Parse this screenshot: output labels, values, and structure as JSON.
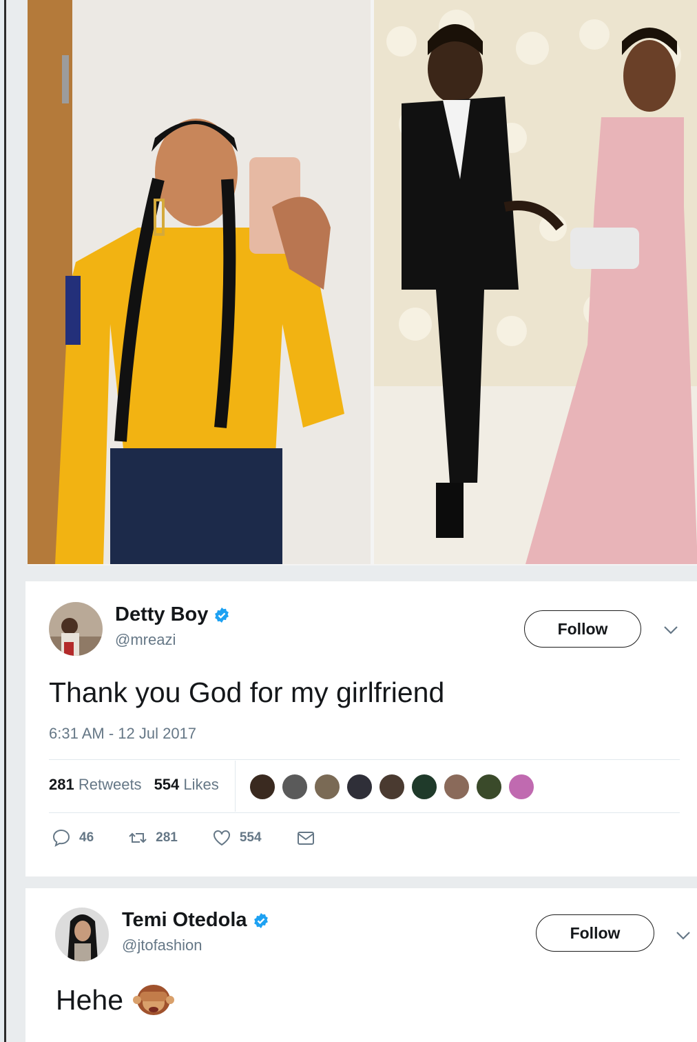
{
  "tweet1": {
    "display_name": "Detty Boy",
    "handle": "@mreazi",
    "follow_label": "Follow",
    "text": "Thank you God for my girlfriend",
    "timestamp": "6:31 AM - 12 Jul 2017",
    "retweets_count": "281",
    "retweets_label": "Retweets",
    "likes_count": "554",
    "likes_label": "Likes",
    "replies": "46",
    "retweets": "281",
    "likes": "554",
    "liker_colors": [
      "#3a2a20",
      "#5a5a5a",
      "#7a6a55",
      "#2f2f38",
      "#4a3a30",
      "#1f3a2a",
      "#8a6a5a",
      "#3a4a2a",
      "#c06ab0"
    ]
  },
  "tweet2": {
    "display_name": "Temi Otedola",
    "handle": "@jtofashion",
    "follow_label": "Follow",
    "text": "Hehe"
  },
  "colors": {
    "verified": "#1da1f2",
    "muted": "#657786",
    "card": "#ffffff"
  }
}
